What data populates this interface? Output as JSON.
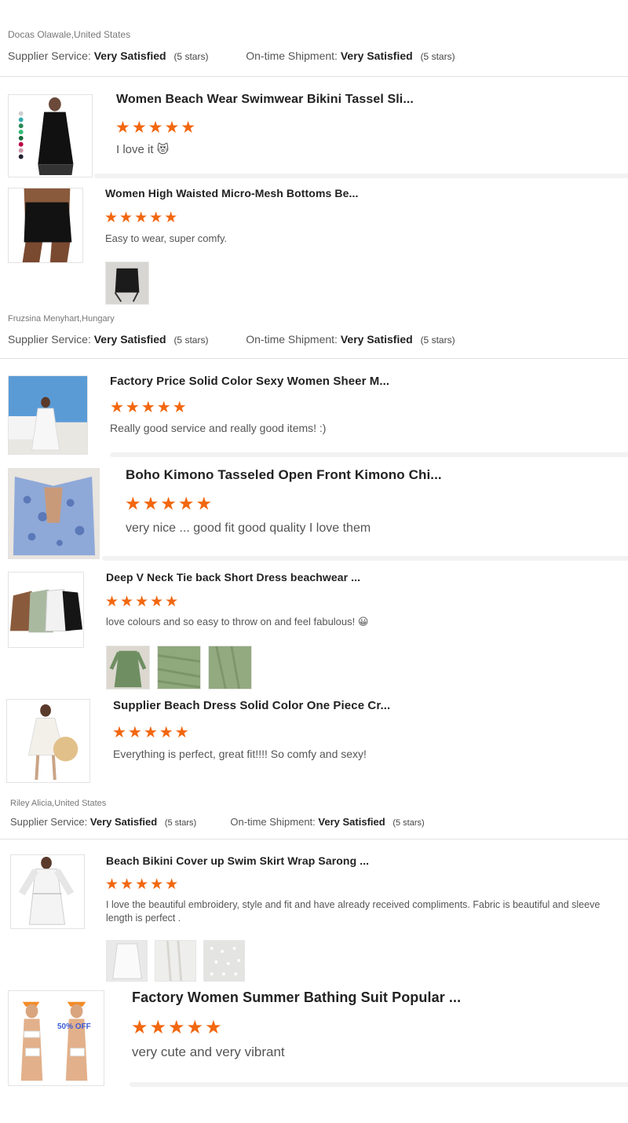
{
  "colors": {
    "star": "#f2670f",
    "divider": "#e2e2e2",
    "soft_divider": "#f2f2f2"
  },
  "rating_labels": {
    "supplier": "Supplier Service:",
    "shipment": "On-time Shipment:",
    "value": "Very Satisfied",
    "stars": "(5 stars)"
  },
  "star_glyphs": "★★★★★",
  "groups": [
    {
      "reviewer": "Docas Olawale,United States",
      "items": [
        {
          "title": "Women Beach Wear Swimwear Bikini Tassel Sli...",
          "rating": 5,
          "comment": "I love it 😻",
          "thumb_icon": "black-tassel-dress-image",
          "photos": []
        },
        {
          "title": "Women High Waisted Micro-Mesh Bottoms Be...",
          "rating": 5,
          "comment": "Easy to wear, super comfy.",
          "thumb_icon": "mesh-skirt-image",
          "photos": [
            "mesh-skirt-photo"
          ]
        }
      ]
    },
    {
      "reviewer": "Fruzsina Menyhart,Hungary",
      "items": [
        {
          "title": "Factory Price Solid Color Sexy Women Sheer M...",
          "rating": 5,
          "comment": "Really good service and really good items! :)",
          "thumb_icon": "white-coverup-beach-image",
          "photos": []
        },
        {
          "title": "Boho Kimono Tasseled Open Front Kimono Chi...",
          "rating": 5,
          "comment": "very nice ... good fit good quality I love them",
          "thumb_icon": "blue-kimono-image",
          "photos": []
        },
        {
          "title": "Deep V Neck Tie back Short Dress beachwear ...",
          "rating": 5,
          "comment": "love colours and so easy to throw on and feel fabulous! 😀",
          "thumb_icon": "dress-colors-image",
          "photos": [
            "green-dress-photo",
            "green-fabric-photo",
            "green-fabric-closeup-photo"
          ]
        },
        {
          "title": "Supplier Beach Dress Solid Color One Piece Cr...",
          "rating": 5,
          "comment": "Everything is perfect, great fit!!!! So comfy and sexy!",
          "thumb_icon": "white-crochet-dress-image",
          "photos": []
        }
      ]
    },
    {
      "reviewer": "Riley Alicia,United States",
      "items": [
        {
          "title": "Beach Bikini Cover up Swim Skirt Wrap Sarong ...",
          "rating": 5,
          "comment": "I love the beautiful embroidery, style and fit and have already received compliments. Fabric is beautiful and sleeve length is perfect .",
          "thumb_icon": "white-robe-image",
          "photos": [
            "white-robe-photo",
            "white-fabric-photo",
            "white-lace-photo"
          ]
        },
        {
          "title": "Factory Women Summer Bathing Suit Popular ...",
          "rating": 5,
          "comment": "very cute and very vibrant",
          "thumb_icon": "bikini-models-image",
          "thumb_badge": "50% OFF",
          "photos": []
        }
      ]
    }
  ]
}
